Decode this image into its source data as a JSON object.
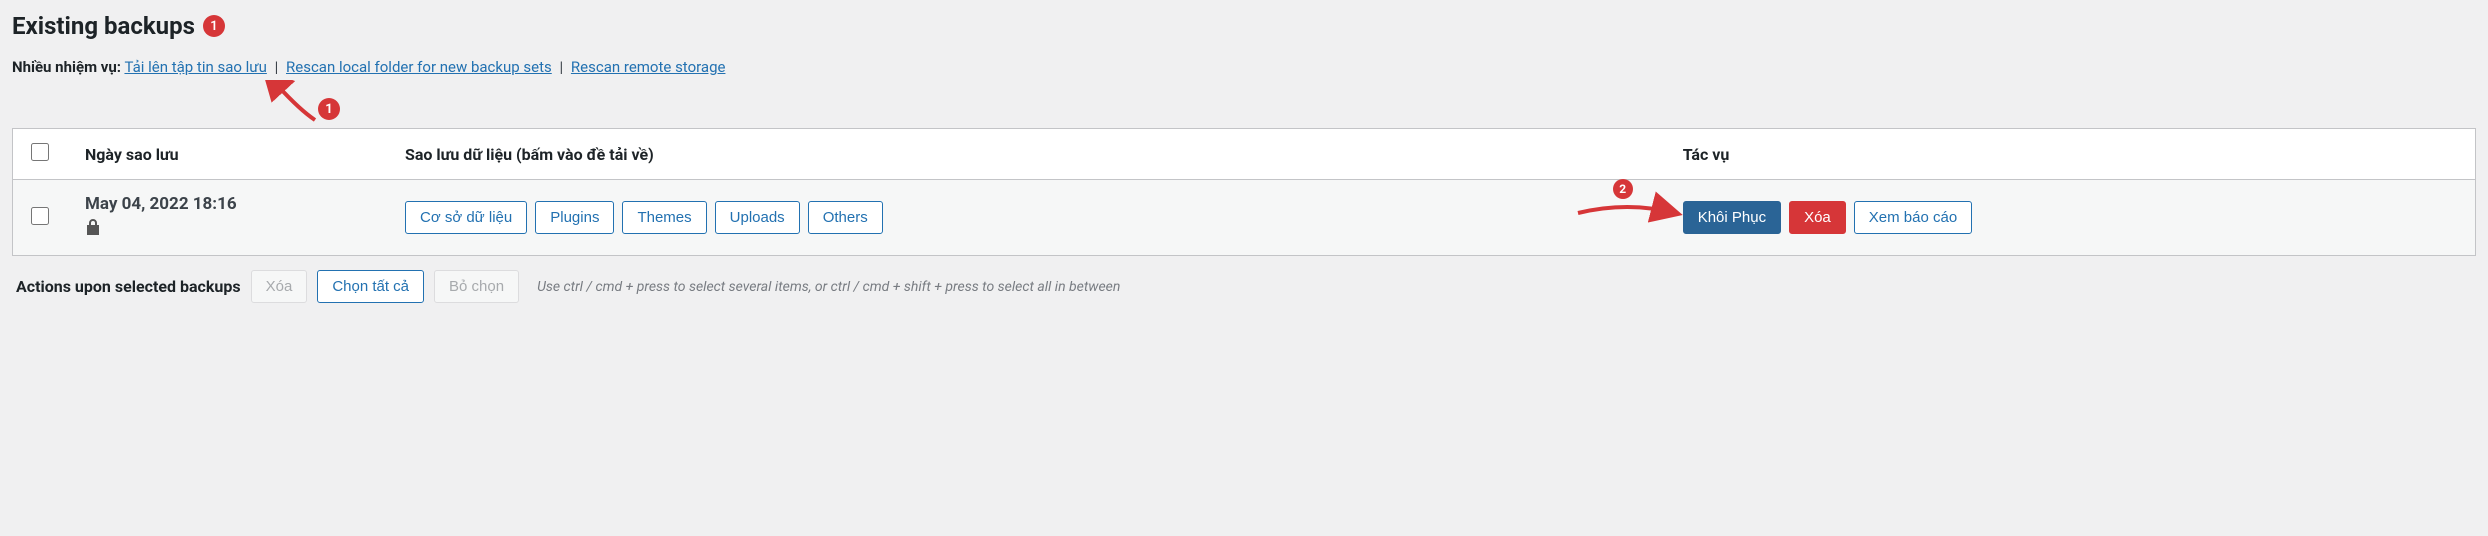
{
  "heading": "Existing backups",
  "heading_badge": "1",
  "tasks": {
    "label": "Nhiều nhiệm vụ:",
    "upload": "Tải lên tập tin sao lưu",
    "rescan_local": "Rescan local folder for new backup sets",
    "rescan_remote": "Rescan remote storage"
  },
  "annotations": {
    "ann1": "1",
    "ann2": "2"
  },
  "table": {
    "headers": {
      "date": "Ngày sao lưu",
      "data": "Sao lưu dữ liệu (bấm vào đề tải về)",
      "actions": "Tác vụ"
    },
    "row": {
      "date": "May 04, 2022 18:16",
      "data_buttons": {
        "db": "Cơ sở dữ liệu",
        "plugins": "Plugins",
        "themes": "Themes",
        "uploads": "Uploads",
        "others": "Others"
      },
      "action_buttons": {
        "restore": "Khôi Phục",
        "delete": "Xóa",
        "report": "Xem báo cáo"
      }
    }
  },
  "bottom": {
    "label": "Actions upon selected backups",
    "delete": "Xóa",
    "select_all": "Chọn tất cả",
    "deselect": "Bỏ chọn",
    "hint": "Use ctrl / cmd + press to select several items, or ctrl / cmd + shift + press to select all in between"
  }
}
